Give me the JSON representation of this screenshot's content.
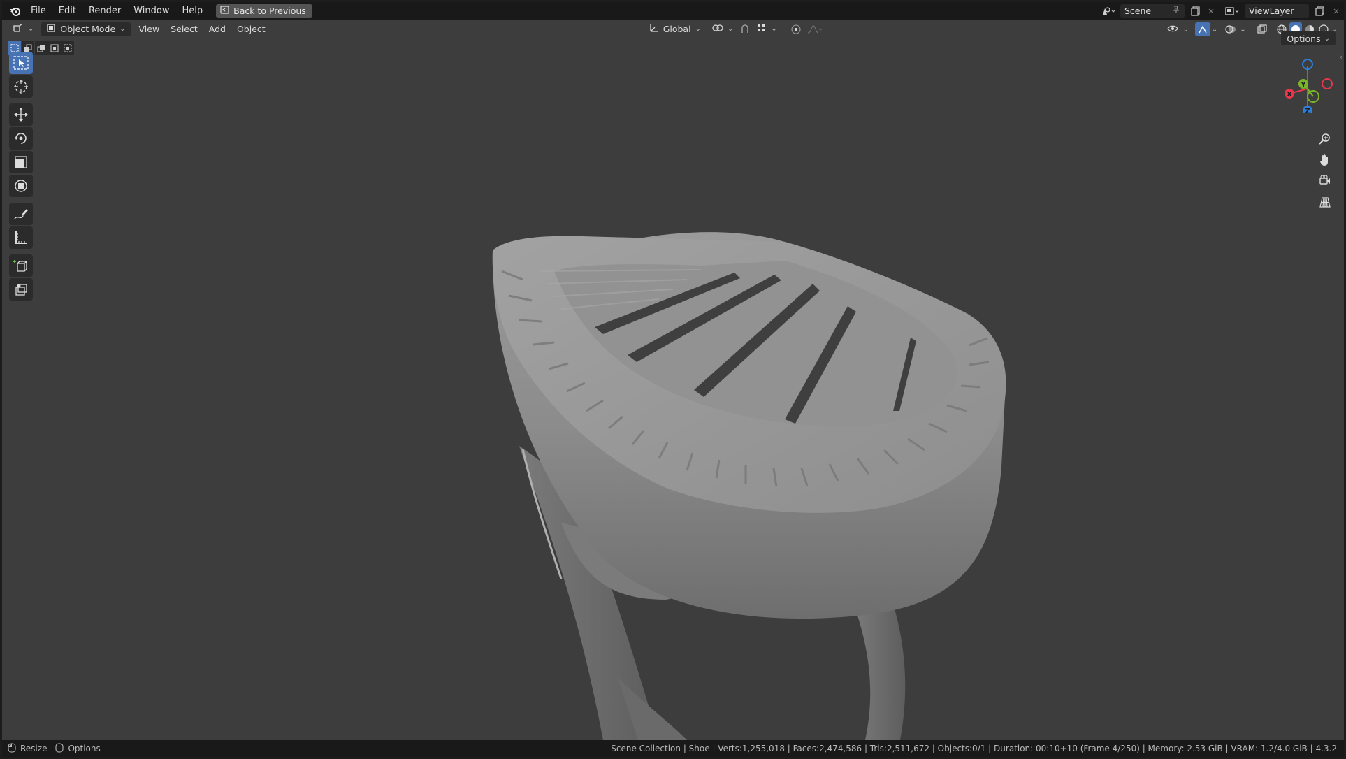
{
  "menu": {
    "items": [
      "File",
      "Edit",
      "Render",
      "Window",
      "Help"
    ],
    "back_button": "Back to Previous",
    "scene_label": "Scene",
    "view_layer_label": "ViewLayer"
  },
  "viewport_header": {
    "mode": "Object Mode",
    "items": [
      "View",
      "Select",
      "Add",
      "Object"
    ],
    "transform_orientation": "Global",
    "options_label": "Options"
  },
  "gizmo": {
    "x_label": "X",
    "y_label": "Y",
    "z_label": "Z"
  },
  "status": {
    "left_resize": "Resize",
    "left_options": "Options",
    "info": "Scene Collection | Shoe | Verts:1,255,018 | Faces:2,474,586 | Tris:2,511,672 | Objects:0/1 | Duration: 00:10+10 (Frame 4/250) | Memory: 2.53 GiB | VRAM: 1.2/4.0 GiB | 4.3.2"
  },
  "colors": {
    "accent": "#4772b3",
    "axis_x": "#e8374d",
    "axis_y": "#7bb32a",
    "axis_z": "#2f7fd8",
    "viewport_bg": "#3d3d3d"
  },
  "icons": [
    "blender-logo-icon",
    "back-icon",
    "editor-type-icon",
    "object-mode-icon",
    "select-box-icon",
    "cursor-icon",
    "move-icon",
    "rotate-icon",
    "scale-icon",
    "transform-icon",
    "annotate-icon",
    "measure-icon",
    "add-cube-icon",
    "extrude-icon",
    "zoom-icon",
    "pan-hand-icon",
    "camera-view-icon",
    "grid-view-icon"
  ]
}
